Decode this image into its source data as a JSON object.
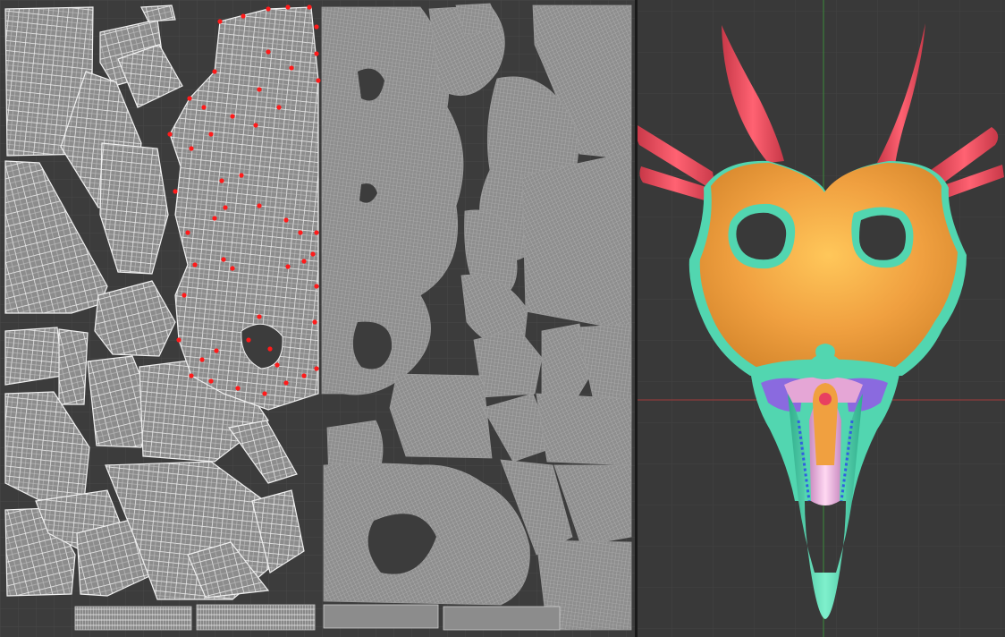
{
  "panels": {
    "uv_editor": {
      "name": "uv-editor"
    },
    "viewport_3d": {
      "name": "3d-viewport"
    }
  },
  "colors": {
    "uv_background": "#3c3c3c",
    "uv_grid": "#4a4a4a",
    "uv_island_fill": "#888888",
    "uv_wire": "#e8e8e8",
    "uv_dense_wire": "#b5b5b5",
    "selected_vertex": "#ff1a1a",
    "viewport_background": "#393939",
    "axis_x": "#a23a3a",
    "axis_y": "#3a8a3a",
    "skull_orange": "#f0a040",
    "horn_red": "#e85060",
    "teal_shell": "#52d6b0",
    "purple_part": "#8a6adf",
    "pink_part": "#e5a6d6"
  },
  "mesh": {
    "object": "creature-skull-mask",
    "parts": [
      "skull-cap",
      "horns",
      "eye-rims",
      "beak",
      "jaw-inner"
    ]
  }
}
